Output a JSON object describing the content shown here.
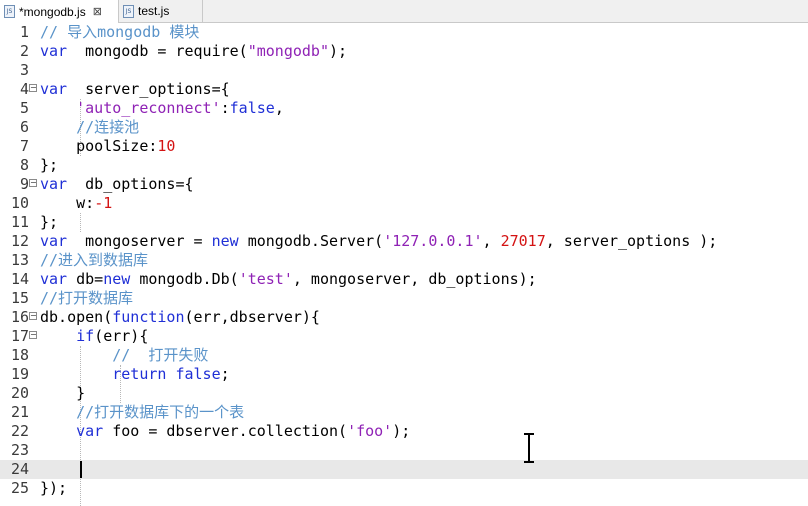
{
  "tabs": [
    {
      "label": "*mongodb.js",
      "active": true,
      "closable": true,
      "icon": "js-file-icon"
    },
    {
      "label": "test.js",
      "active": false,
      "closable": false,
      "icon": "js-file-icon"
    }
  ],
  "editor": {
    "current_line": 24,
    "lines": [
      {
        "n": "1",
        "seg": [
          [
            "cm",
            "// 导入mongodb 模块"
          ]
        ]
      },
      {
        "n": "2",
        "seg": [
          [
            "kw",
            "var"
          ],
          [
            "",
            "  mongodb = require("
          ],
          [
            "str",
            "\"mongodb\""
          ],
          [
            "",
            ");"
          ]
        ]
      },
      {
        "n": "3",
        "seg": []
      },
      {
        "n": "4",
        "fold": true,
        "seg": [
          [
            "kw",
            "var"
          ],
          [
            "",
            "  server_options={"
          ]
        ]
      },
      {
        "n": "5",
        "seg": [
          [
            "",
            "    "
          ],
          [
            "str",
            "'auto_reconnect'"
          ],
          [
            "",
            ":"
          ],
          [
            "kw",
            "false"
          ],
          [
            "",
            ","
          ]
        ]
      },
      {
        "n": "6",
        "seg": [
          [
            "",
            "    "
          ],
          [
            "cm",
            "//连接池"
          ]
        ]
      },
      {
        "n": "7",
        "seg": [
          [
            "",
            "    poolSize:"
          ],
          [
            "num",
            "10"
          ]
        ]
      },
      {
        "n": "8",
        "seg": [
          [
            "",
            "};"
          ]
        ]
      },
      {
        "n": "9",
        "fold": true,
        "seg": [
          [
            "kw",
            "var"
          ],
          [
            "",
            "  db_options={"
          ]
        ]
      },
      {
        "n": "10",
        "seg": [
          [
            "",
            "    w:"
          ],
          [
            "num",
            "-1"
          ]
        ]
      },
      {
        "n": "11",
        "seg": [
          [
            "",
            "};"
          ]
        ]
      },
      {
        "n": "12",
        "seg": [
          [
            "kw",
            "var"
          ],
          [
            "",
            "  mongoserver = "
          ],
          [
            "kw",
            "new"
          ],
          [
            "",
            " mongodb.Server("
          ],
          [
            "str",
            "'127.0.0.1'"
          ],
          [
            "",
            ", "
          ],
          [
            "num",
            "27017"
          ],
          [
            "",
            ", server_options );"
          ]
        ]
      },
      {
        "n": "13",
        "seg": [
          [
            "cm",
            "//进入到数据库"
          ]
        ]
      },
      {
        "n": "14",
        "seg": [
          [
            "kw",
            "var"
          ],
          [
            "",
            " db="
          ],
          [
            "kw",
            "new"
          ],
          [
            "",
            " mongodb.Db("
          ],
          [
            "str",
            "'test'"
          ],
          [
            "",
            ", mongoserver, db_options);"
          ]
        ]
      },
      {
        "n": "15",
        "seg": [
          [
            "cm",
            "//打开数据库"
          ]
        ]
      },
      {
        "n": "16",
        "fold": true,
        "seg": [
          [
            "",
            "db.open("
          ],
          [
            "kw",
            "function"
          ],
          [
            "",
            "(err,dbserver){"
          ]
        ]
      },
      {
        "n": "17",
        "fold": true,
        "seg": [
          [
            "",
            "    "
          ],
          [
            "kw",
            "if"
          ],
          [
            "",
            "(err){"
          ]
        ]
      },
      {
        "n": "18",
        "seg": [
          [
            "",
            "        "
          ],
          [
            "cm",
            "//  打开失败"
          ]
        ]
      },
      {
        "n": "19",
        "seg": [
          [
            "",
            "        "
          ],
          [
            "kw",
            "return false"
          ],
          [
            "",
            ";"
          ]
        ]
      },
      {
        "n": "20",
        "seg": [
          [
            "",
            "    }"
          ]
        ]
      },
      {
        "n": "21",
        "seg": [
          [
            "",
            "    "
          ],
          [
            "cm",
            "//打开数据库下的一个表"
          ]
        ]
      },
      {
        "n": "22",
        "seg": [
          [
            "",
            "    "
          ],
          [
            "kw",
            "var"
          ],
          [
            "",
            " foo = dbserver.collection("
          ],
          [
            "str",
            "'foo'"
          ],
          [
            "",
            ");"
          ]
        ]
      },
      {
        "n": "23",
        "seg": []
      },
      {
        "n": "24",
        "seg": [
          [
            "",
            "    "
          ]
        ]
      },
      {
        "n": "25",
        "seg": [
          [
            "",
            "});"
          ]
        ]
      }
    ]
  },
  "colors": {
    "keyword": "#1f2fd6",
    "string": "#8f22b5",
    "number": "#d41313",
    "comment": "#5a93c9",
    "current_line_bg": "#e8e8e8"
  },
  "icons": {
    "tab_close": "close-icon",
    "fold_marker": "fold-minus-icon",
    "mouse_cursor": "text-ibeam-cursor-icon"
  }
}
